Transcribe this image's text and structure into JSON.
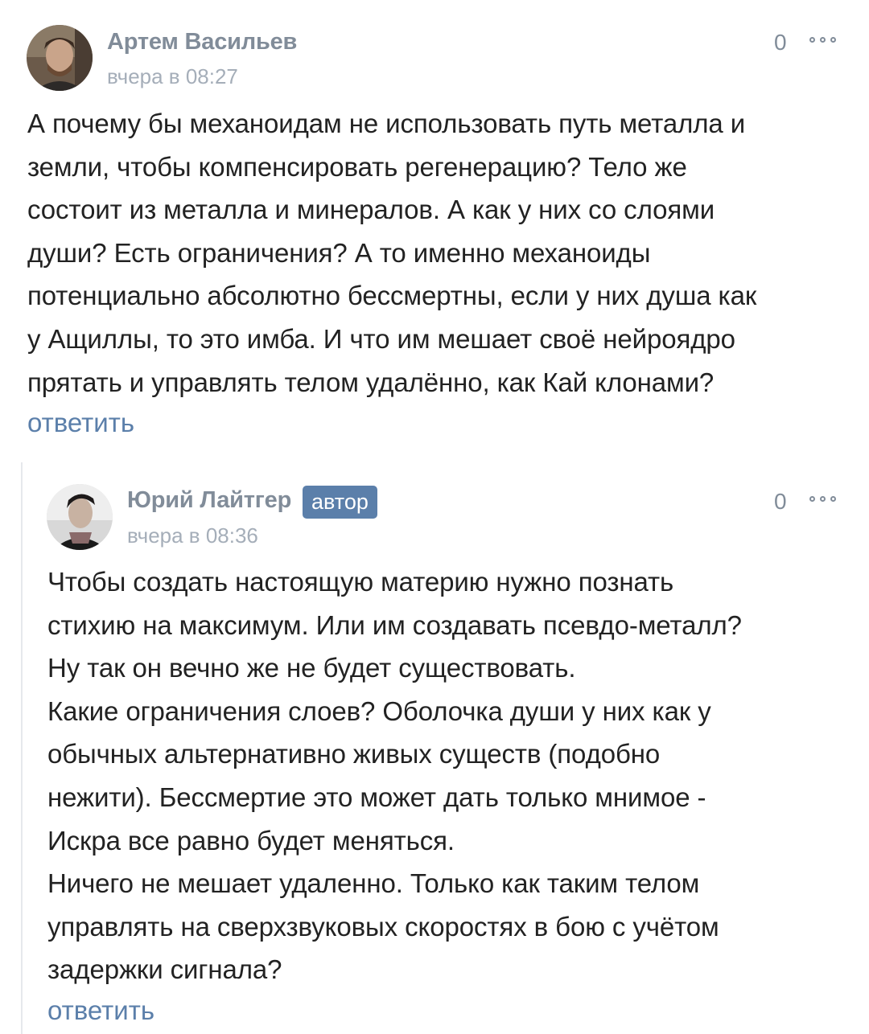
{
  "comments": [
    {
      "author": "Артем Васильев",
      "time": "вчера в 08:27",
      "likes": "0",
      "text": "А почему бы механоидам не использовать путь металла и\nземли, чтобы компенсировать регенерацию? Тело же\nсостоит из металла и минералов. А как у них со слоями\nдуши? Есть ограничения? А то именно механоиды\nпотенциально абсолютно бессмертны, если у них душа как\nу Ащиллы, то это имба. И что им мешает своё нейроядро\nпрятать и управлять телом удалённо, как Кай клонами?",
      "reply": "ответить"
    },
    {
      "author": "Юрий Лайтгер",
      "badge": "автор",
      "time": "вчера в 08:36",
      "likes": "0",
      "text": "Чтобы создать настоящую материю нужно познать\nстихию на максимум. Или им создавать псевдо-металл?\nНу так он вечно же не будет существовать.\nКакие ограничения слоев? Оболочка души у них как у\nобычных альтернативно живых существ (подобно\nнежити). Бессмертие это может дать только мнимое -\nИскра все равно будет меняться.\nНичего не мешает удаленно. Только как таким телом\nуправлять на сверхзвуковых скоростях в бою с учётом\nзадержки сигнала?",
      "reply": "ответить"
    }
  ],
  "icons": {
    "more": "more-dots-icon"
  },
  "colors": {
    "link": "#5b7faa",
    "badge": "#5b7faa",
    "meta": "#818c99"
  }
}
